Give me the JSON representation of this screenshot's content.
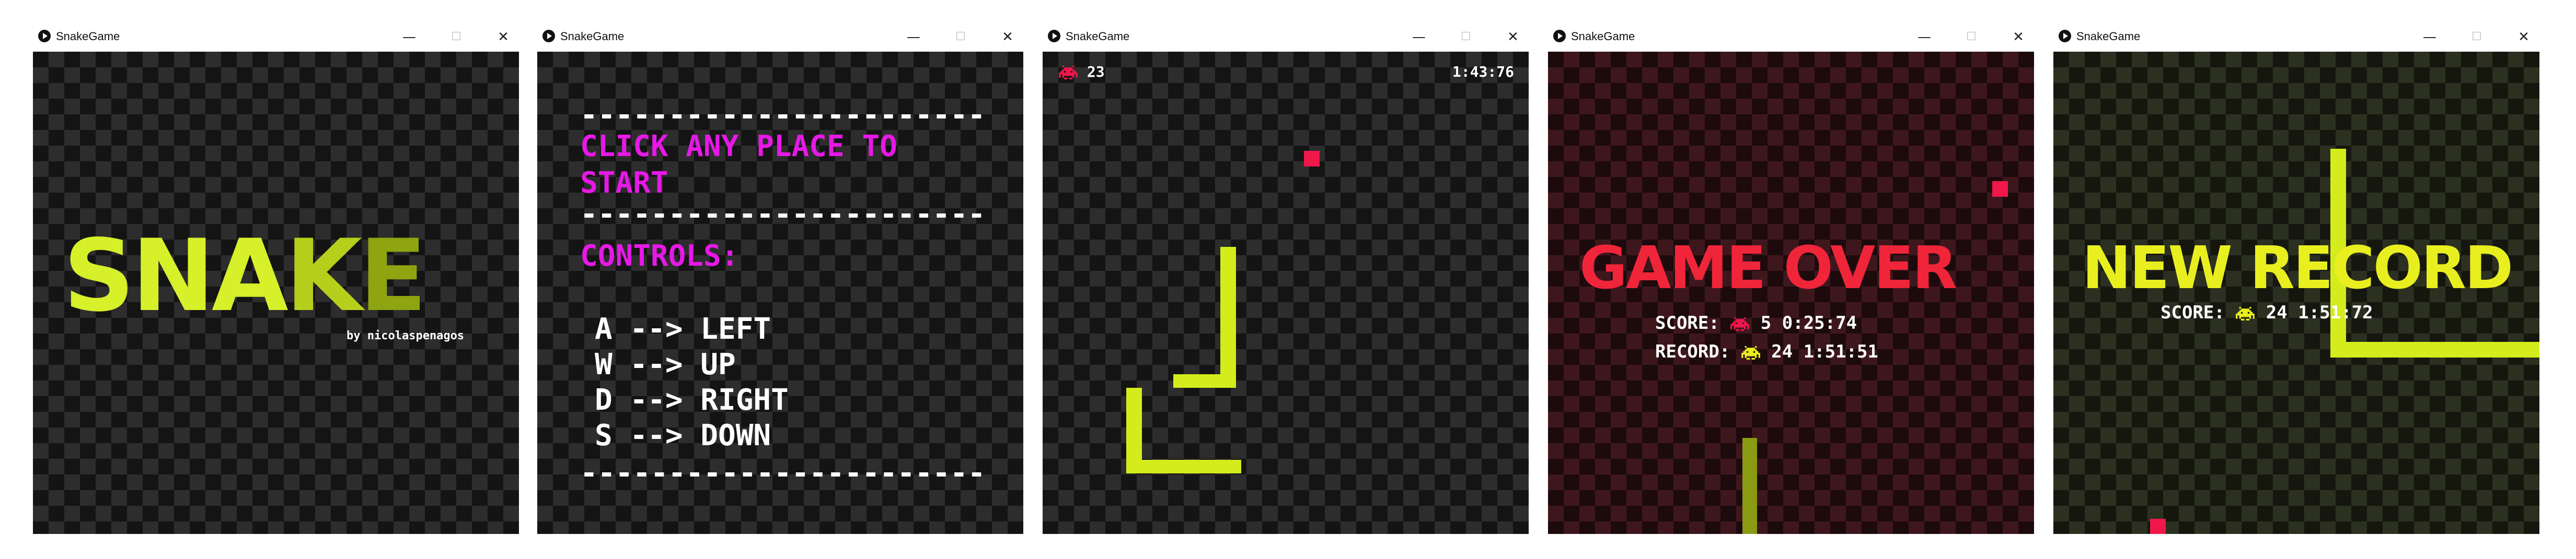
{
  "window_title": "SnakeGame",
  "window_controls": {
    "minimize": "—",
    "maximize": "☐",
    "close": "✕"
  },
  "colors": {
    "snake": "#d4ec1b",
    "snake_dim": "#8a9a12",
    "food": "#f0174a",
    "menu_accent": "#e619e6",
    "game_over": "#f0253a",
    "new_record": "#e9ef1f"
  },
  "screens": {
    "title": {
      "logo": {
        "part1": "SNA",
        "part2": "K",
        "part3": "E"
      },
      "subtitle": "by nicolaspenagos"
    },
    "menu": {
      "divider": "-----------------------",
      "prompt_line1": "CLICK ANY PLACE TO",
      "prompt_line2": "START",
      "controls_heading": "CONTROLS:",
      "controls": [
        "A --> LEFT",
        "W --> UP",
        "D --> RIGHT",
        "S --> DOWN"
      ]
    },
    "gameplay": {
      "score": "23",
      "score_icon": "alien-icon",
      "time": "1:43:76"
    },
    "game_over": {
      "banner": "GAME OVER",
      "score_label": "SCORE:",
      "score_value": "5",
      "score_time": "0:25:74",
      "record_label": "RECORD:",
      "record_value": "24",
      "record_time": "1:51:51"
    },
    "new_record": {
      "banner": "NEW RECORD",
      "score_label": "SCORE:",
      "score_value": "24",
      "score_time": "1:51:72"
    }
  }
}
